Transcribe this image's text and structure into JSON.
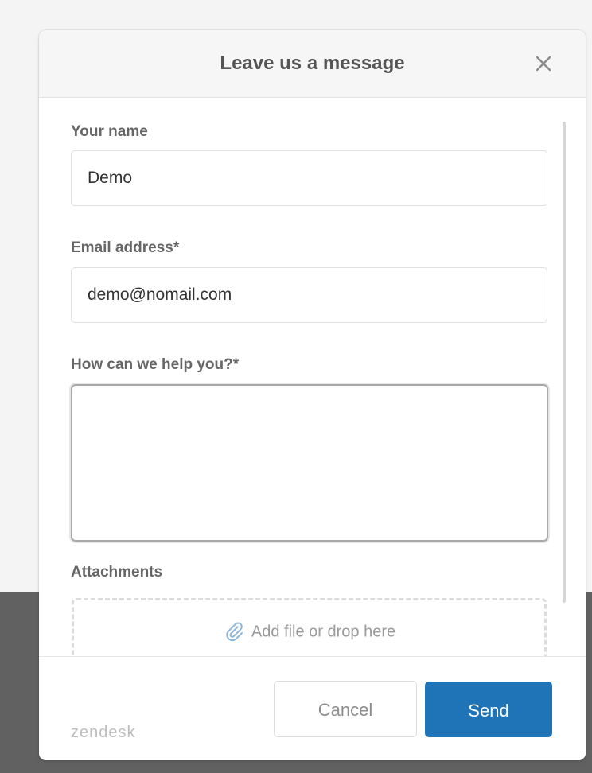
{
  "widget": {
    "title": "Leave us a message",
    "close_icon": "close-icon"
  },
  "form": {
    "name": {
      "label": "Your name",
      "value": "Demo"
    },
    "email": {
      "label": "Email address*",
      "value": "demo@nomail.com"
    },
    "message": {
      "label": "How can we help you?*",
      "value": ""
    },
    "attachments": {
      "label": "Attachments",
      "dropzone_text": "Add file or drop here",
      "icon": "paperclip-icon"
    }
  },
  "footer": {
    "brand": "zendesk",
    "cancel_label": "Cancel",
    "send_label": "Send"
  },
  "colors": {
    "primary": "#1f73b7",
    "page_background": "#f4f4f4",
    "dark_background": "#616161"
  }
}
